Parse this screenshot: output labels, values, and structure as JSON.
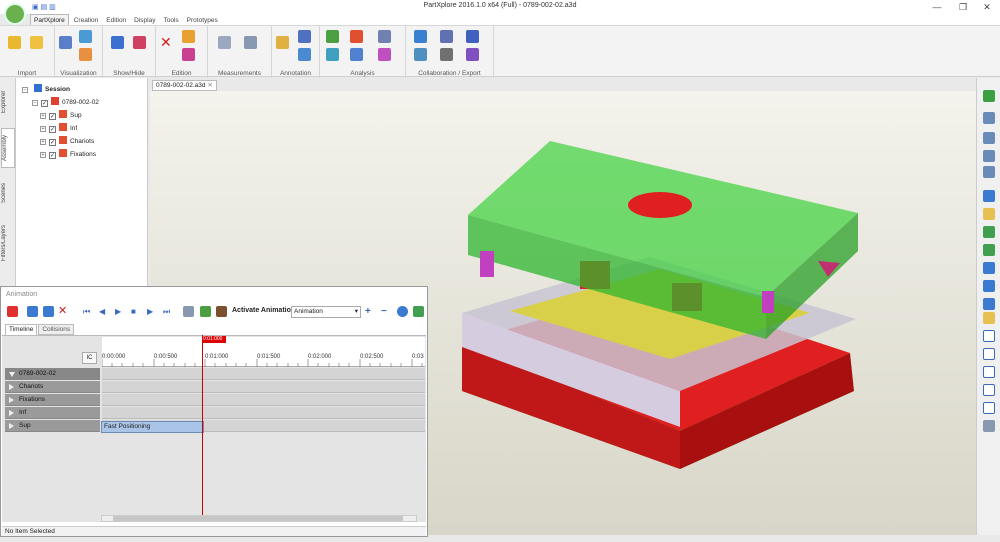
{
  "window": {
    "title": "PartXplore 2016.1.0 x64 (Full) - 0789-002-02.a3d",
    "minimize": "—",
    "maximize": "❐",
    "close": "✕"
  },
  "ribbon_tabs": [
    "PartXplore",
    "Creation",
    "Edition",
    "Display",
    "Tools",
    "Prototypes"
  ],
  "ribbon_groups": [
    "Import",
    "Visualization",
    "Show/Hide",
    "Edition",
    "Measurements",
    "Annotation",
    "Analysis",
    "Collaboration / Export"
  ],
  "side_tabs": [
    "Explorer",
    "Assembly",
    "Scenes",
    "Filters/Layers"
  ],
  "tree": {
    "root": "Session",
    "model": "0789-002-02",
    "children": [
      "Sup",
      "Inf",
      "Chariots",
      "Fixations"
    ]
  },
  "viewport": {
    "tab": "0789-002-02.a3d"
  },
  "animation": {
    "title": "Animation",
    "activate_label": "Activate Animation",
    "mode_select": "Animation",
    "tabs": [
      "Timeline",
      "Collisions"
    ],
    "ic_button": "IC",
    "ruler_ticks": [
      "0:00:000",
      "0:00:500",
      "0:01:000",
      "0:01:500",
      "0:02:000",
      "0:02:500",
      "0:03"
    ],
    "cursor_time": "0:01:000",
    "root_row": "0789-002-02",
    "rows": [
      "Chariots",
      "Fixations",
      "Inf",
      "Sup"
    ],
    "clip": {
      "label": "Fast Positioning",
      "row": "Sup",
      "start": "0:00:000",
      "end": "0:01:000"
    },
    "status": "No Item Selected"
  }
}
